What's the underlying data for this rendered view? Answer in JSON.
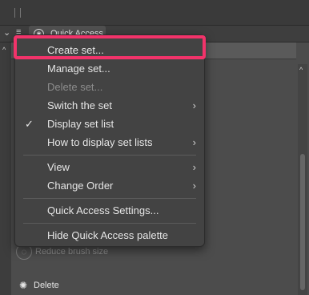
{
  "tab": {
    "title": "Quick Access",
    "icon": "quick-access-icon"
  },
  "menu": {
    "items": [
      {
        "label": "Create set...",
        "disabled": false,
        "checked": false,
        "submenu": false
      },
      {
        "label": "Manage set...",
        "disabled": false,
        "checked": false,
        "submenu": false
      },
      {
        "label": "Delete set...",
        "disabled": true,
        "checked": false,
        "submenu": false
      },
      {
        "label": "Switch the set",
        "disabled": false,
        "checked": false,
        "submenu": true
      },
      {
        "label": "Display set list",
        "disabled": false,
        "checked": true,
        "submenu": false
      },
      {
        "label": "How to display set lists",
        "disabled": false,
        "checked": false,
        "submenu": true
      },
      {
        "label": "View",
        "disabled": false,
        "checked": false,
        "submenu": true
      },
      {
        "label": "Change Order",
        "disabled": false,
        "checked": false,
        "submenu": true
      },
      {
        "label": "Quick Access Settings...",
        "disabled": false,
        "checked": false,
        "submenu": false
      },
      {
        "label": "Hide Quick Access palette",
        "disabled": false,
        "checked": false,
        "submenu": false
      }
    ],
    "check_glyph": "✓",
    "submenu_glyph": "›"
  },
  "palette": {
    "items": [
      {
        "label": "Reduce brush size",
        "icon": "reduce-brush-size-icon"
      },
      {
        "label": "Delete",
        "icon": "delete-spinner-icon"
      }
    ]
  },
  "colors": {
    "highlight": "#f2336a",
    "menu_bg": "#434343",
    "panel_bg": "#4c4c4c"
  }
}
